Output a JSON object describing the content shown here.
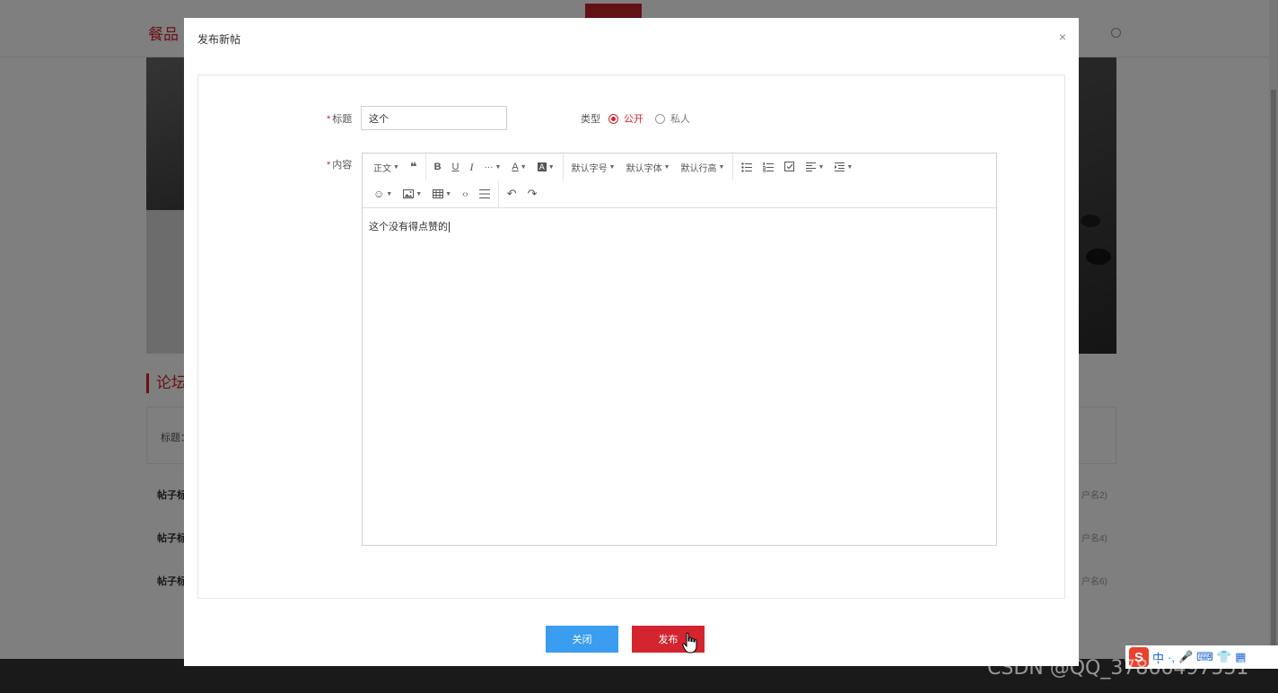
{
  "background": {
    "logo": "餐品",
    "section_title": "论坛",
    "search_label": "标题：",
    "rows": [
      {
        "title": "帖子标",
        "user": "户名2)"
      },
      {
        "title": "帖子标",
        "user": "户名4)"
      },
      {
        "title": "帖子标",
        "user": "户名6)"
      }
    ]
  },
  "dialog": {
    "title": "发布新帖",
    "close_glyph": "×",
    "form": {
      "title_label": "标题",
      "title_value": "这个",
      "type_label": "类型",
      "type_options": [
        {
          "label": "公开",
          "checked": true
        },
        {
          "label": "私人",
          "checked": false
        }
      ],
      "content_label": "内容",
      "required_mark": "*"
    },
    "editor": {
      "toolbar": {
        "heading": "正文",
        "quote": "❝",
        "bold": "B",
        "underline": "U",
        "italic": "I",
        "more": "···",
        "font_color": "A",
        "bg_color": "A",
        "font_size": "默认字号",
        "font_family": "默认字体",
        "line_height": "默认行高",
        "emoji": "☺",
        "code": "‹›",
        "undo": "↶",
        "redo": "↷"
      },
      "content": "这个没有得点赞的"
    },
    "buttons": {
      "close": "关闭",
      "publish": "发布"
    }
  },
  "taskbar": {
    "ime": "中",
    "watermark": "CSDN @QQ_37866497531"
  },
  "colors": {
    "brand_red": "#d3242f",
    "primary_blue": "#3a9df0"
  }
}
